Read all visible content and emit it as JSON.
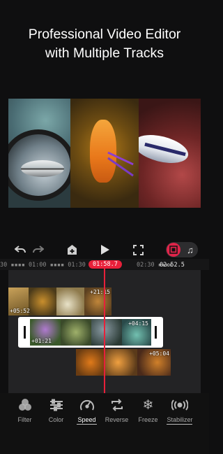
{
  "headline": {
    "line1": "Professional Video Editor",
    "line2": "with Multiple Tracks"
  },
  "toolbar": {
    "buttons": [
      "undo",
      "redo",
      "add-clip",
      "play",
      "fullscreen"
    ],
    "mode_toggle": {
      "video_icon": "film-icon",
      "audio_icon": "music-note-icon",
      "active": "video"
    }
  },
  "ruler": {
    "marks": [
      "30 ▪▪▪▪ 01:00 ▪▪▪▪ 01:30",
      "02:30 ▪▪▪▪ ",
      "02:52.5"
    ],
    "playhead_time": "01:58.7"
  },
  "timeline": {
    "track1": {
      "start": "+05:52",
      "end": "+21:15"
    },
    "track2": {
      "start": "+01:21",
      "end": "+04:15"
    },
    "track3": {
      "end": "+05:04"
    }
  },
  "tools": [
    {
      "label": "Filter",
      "icon": "filter-circles-icon"
    },
    {
      "label": "Color",
      "icon": "sliders-icon"
    },
    {
      "label": "Speed",
      "icon": "speedometer-icon"
    },
    {
      "label": "Reverse",
      "icon": "reverse-icon"
    },
    {
      "label": "Freeze",
      "icon": "snowflake-icon"
    },
    {
      "label": "Stabilizer",
      "icon": "stabilizer-icon"
    }
  ],
  "colors": {
    "accent": "#e0244a",
    "playhead": "#e8203a",
    "selection": "#ffffff"
  }
}
